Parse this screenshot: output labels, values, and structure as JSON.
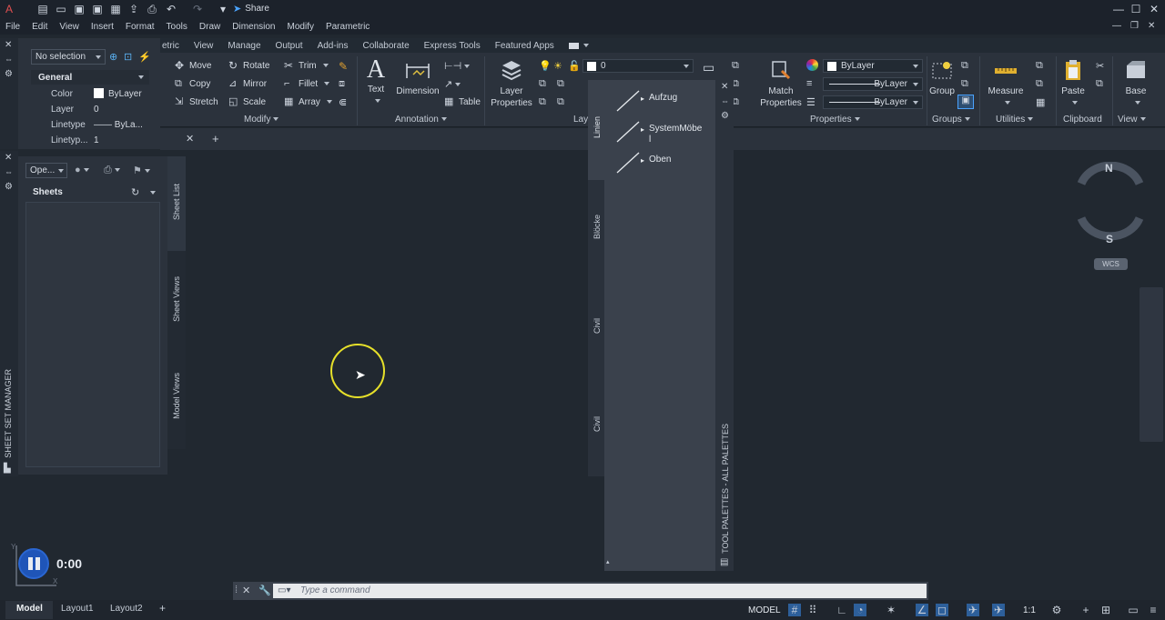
{
  "titlebar": {
    "share_label": "Share"
  },
  "menu": [
    "File",
    "Edit",
    "View",
    "Insert",
    "Format",
    "Tools",
    "Draw",
    "Dimension",
    "Modify",
    "Parametric"
  ],
  "ribbon_tabs": [
    "etric",
    "View",
    "Manage",
    "Output",
    "Add-ins",
    "Collaborate",
    "Express Tools",
    "Featured Apps"
  ],
  "modify": {
    "move": "Move",
    "rotate": "Rotate",
    "trim": "Trim",
    "copy": "Copy",
    "mirror": "Mirror",
    "fillet": "Fillet",
    "stretch": "Stretch",
    "scale": "Scale",
    "array": "Array",
    "panel": "Modify"
  },
  "annotation": {
    "text": "Text",
    "dimension": "Dimension",
    "table": "Table",
    "panel": "Annotation"
  },
  "layers": {
    "layer_properties": "Layer Properties",
    "current_layer": "0",
    "panel": "Lay"
  },
  "properties_panel": {
    "match": "Match Properties",
    "color": "ByLayer",
    "linetype": "ByLayer",
    "lineweight": "ByLayer",
    "panel": "Properties"
  },
  "groups": {
    "group": "Group",
    "panel": "Groups"
  },
  "utilities": {
    "measure": "Measure",
    "panel": "Utilities"
  },
  "clipboard": {
    "paste": "Paste",
    "panel": "Clipboard"
  },
  "view_panel": {
    "base": "Base",
    "panel": "View"
  },
  "props_palette": {
    "selection": "No selection",
    "section": "General",
    "rows": [
      {
        "label": "Color",
        "value": "ByLayer"
      },
      {
        "label": "Layer",
        "value": "0"
      },
      {
        "label": "Linetype",
        "value": "—— ByLa..."
      },
      {
        "label": "Linetyp...",
        "value": "1"
      }
    ]
  },
  "ssm": {
    "open_label": "Ope...",
    "sheets_header": "Sheets",
    "title": "SHEET SET MANAGER",
    "tabs": [
      "Sheet List",
      "Sheet Views",
      "Model Views"
    ]
  },
  "tool_palette": {
    "tabs": [
      "Linien",
      "Blöcke",
      "Civil",
      "Civil"
    ],
    "items": [
      "Aufzug",
      "SystemMöbe l",
      "Oben"
    ],
    "title": "TOOL PALETTES - ALL PALETTES"
  },
  "viewcube": {
    "north": "N",
    "south": "S",
    "wcs": "WCS"
  },
  "command": {
    "placeholder": "Type a command"
  },
  "status": {
    "layouts": [
      "Model",
      "Layout1",
      "Layout2"
    ],
    "space": "MODEL",
    "scale": "1:1"
  },
  "recorder": {
    "time": "0:00"
  },
  "colors": {
    "accent": "#1f55b8",
    "cursor_ring": "#e6e02a",
    "bg": "#212830"
  }
}
